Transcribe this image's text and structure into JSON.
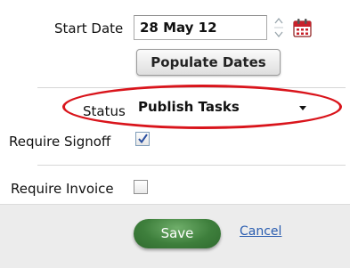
{
  "form": {
    "start_date": {
      "label": "Start Date",
      "value": "28 May 12"
    },
    "populate_button": "Populate Dates",
    "status": {
      "label": "Status",
      "selected": "Publish Tasks"
    },
    "require_signoff": {
      "label": "Require Signoff",
      "checked": true
    },
    "require_invoice": {
      "label": "Require Invoice",
      "checked": false
    }
  },
  "footer": {
    "save_label": "Save",
    "cancel_label": "Cancel"
  },
  "colors": {
    "highlight_ellipse": "#d9141b",
    "save_button": "#3e7f3c",
    "link": "#2a5db0",
    "footer_bg": "#ececec"
  },
  "icons": {
    "date_spinner": "spinner-icon",
    "calendar": "calendar-icon",
    "dropdown": "chevron-down-icon",
    "checkmark": "checkmark-icon"
  }
}
